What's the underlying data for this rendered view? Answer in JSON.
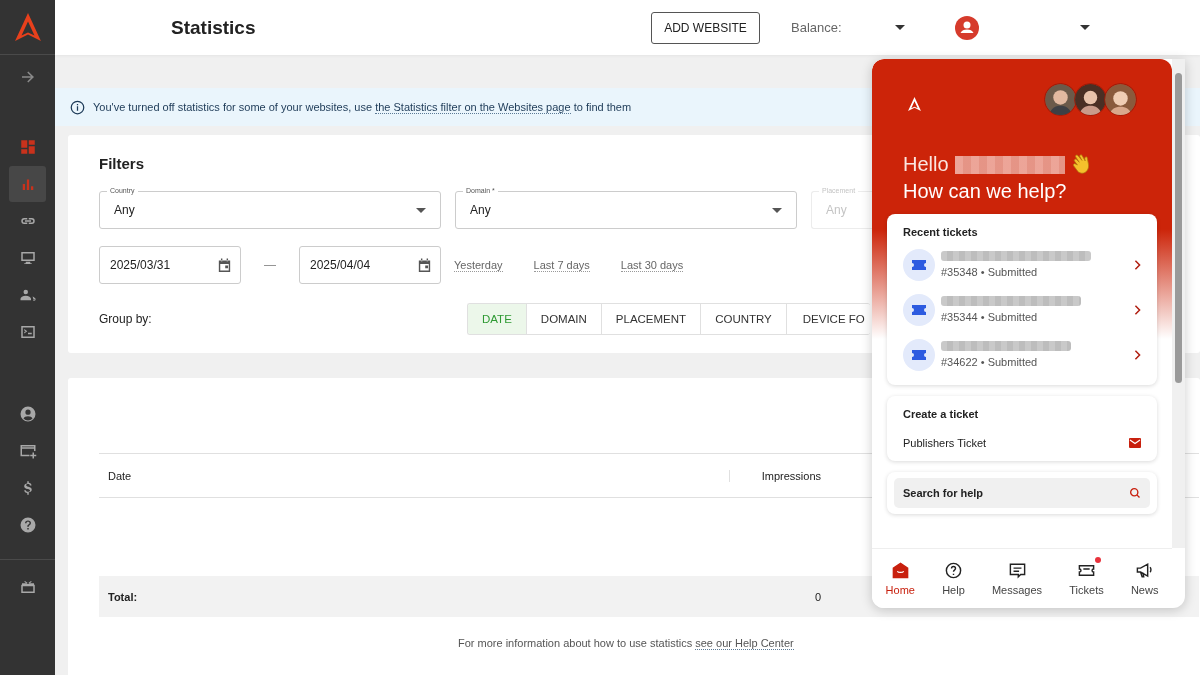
{
  "header": {
    "title": "Statistics",
    "add_button": "ADD WEBSITE",
    "balance_label": "Balance:"
  },
  "sidebar": {
    "top": [
      {
        "kind": "dashboard",
        "selected": false
      },
      {
        "kind": "stats",
        "selected": true
      },
      {
        "kind": "link",
        "selected": false
      },
      {
        "kind": "monitor",
        "selected": false
      },
      {
        "kind": "users",
        "selected": false
      },
      {
        "kind": "terminal",
        "selected": false
      }
    ],
    "bottom": [
      {
        "kind": "account",
        "selected": false
      },
      {
        "kind": "card",
        "selected": false
      },
      {
        "kind": "dollar",
        "selected": false
      },
      {
        "kind": "help",
        "selected": false
      }
    ]
  },
  "notice": {
    "text": "You've turned off statistics for some of your websites, use ",
    "link": "the Statistics filter on the Websites page",
    "after": " to find them"
  },
  "filters": {
    "title": "Filters",
    "selects": [
      {
        "label": "Country",
        "value": "Any",
        "disabled": false
      },
      {
        "label": "Domain *",
        "value": "Any",
        "disabled": false
      },
      {
        "label": "Placement",
        "value": "Any",
        "disabled": true
      }
    ],
    "date_from": "2025/03/31",
    "date_to": "2025/04/04",
    "dash": "—",
    "presets": [
      "Yesterday",
      "Last 7 days",
      "Last 30 days"
    ],
    "group_label": "Group by:",
    "group_options": [
      {
        "label": "DATE",
        "selected": true
      },
      {
        "label": "DOMAIN",
        "selected": false
      },
      {
        "label": "PLACEMENT",
        "selected": false
      },
      {
        "label": "COUNTRY",
        "selected": false
      },
      {
        "label": "DEVICE FO",
        "selected": false
      }
    ]
  },
  "table": {
    "columns": [
      "Date",
      "Impressions"
    ],
    "total_label": "Total:",
    "total_values": [
      "0"
    ]
  },
  "footer": {
    "text": "For more information about how to use statistics ",
    "link": "see our Help Center"
  },
  "chat": {
    "greeting": "Hello",
    "question": "How can we help?",
    "recent_title": "Recent tickets",
    "tickets": [
      {
        "meta": "#35348 • Submitted"
      },
      {
        "meta": "#35344 • Submitted"
      },
      {
        "meta": "#34622 • Submitted"
      }
    ],
    "create_title": "Create a ticket",
    "create_item": "Publishers Ticket",
    "search_label": "Search for help",
    "nav": [
      {
        "kind": "home",
        "label": "Home",
        "selected": true,
        "badge": false
      },
      {
        "kind": "help",
        "label": "Help",
        "selected": false,
        "badge": false
      },
      {
        "kind": "messages",
        "label": "Messages",
        "selected": false,
        "badge": false
      },
      {
        "kind": "tickets",
        "label": "Tickets",
        "selected": false,
        "badge": true
      },
      {
        "kind": "news",
        "label": "News",
        "selected": false,
        "badge": false
      }
    ]
  }
}
